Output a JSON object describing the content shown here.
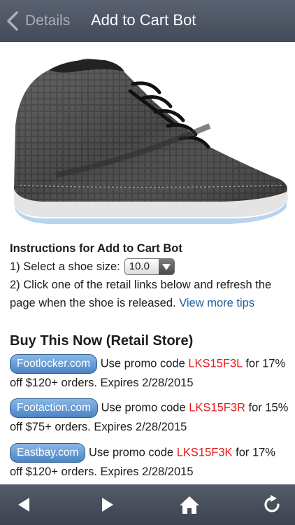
{
  "nav": {
    "back_label": "Details",
    "title": "Add to Cart Bot"
  },
  "instructions": {
    "title": "Instructions for Add to Cart Bot",
    "step1_label": "1) Select a shoe size:",
    "size_value": "10.0",
    "step2_text": "2) Click one of the retail links below and refresh the page when the shoe is released.",
    "more_tips_link": "View more tips"
  },
  "buy": {
    "title": "Buy This Now (Retail Store)",
    "stores": [
      {
        "name": "Footlocker.com",
        "prefix": "Use promo code",
        "code": "LKS15F3L",
        "suffix": "for 17% off $120+ orders. Expires 2/28/2015"
      },
      {
        "name": "Footaction.com",
        "prefix": "Use promo code",
        "code": "LKS15F3R",
        "suffix": "for 15% off $75+ orders. Expires 2/28/2015"
      },
      {
        "name": "Eastbay.com",
        "prefix": "Use promo code",
        "code": "LKS15F3K",
        "suffix": "for 17% off $120+ orders. Expires 2/28/2015"
      }
    ]
  },
  "colors": {
    "navbar": "#4b5261",
    "link": "#1c5d9c",
    "promo": "#e51b1b",
    "store_button": "#5a90cf"
  },
  "toolbar": {
    "icons": [
      "back-arrow-icon",
      "forward-arrow-icon",
      "home-icon",
      "refresh-icon"
    ]
  }
}
